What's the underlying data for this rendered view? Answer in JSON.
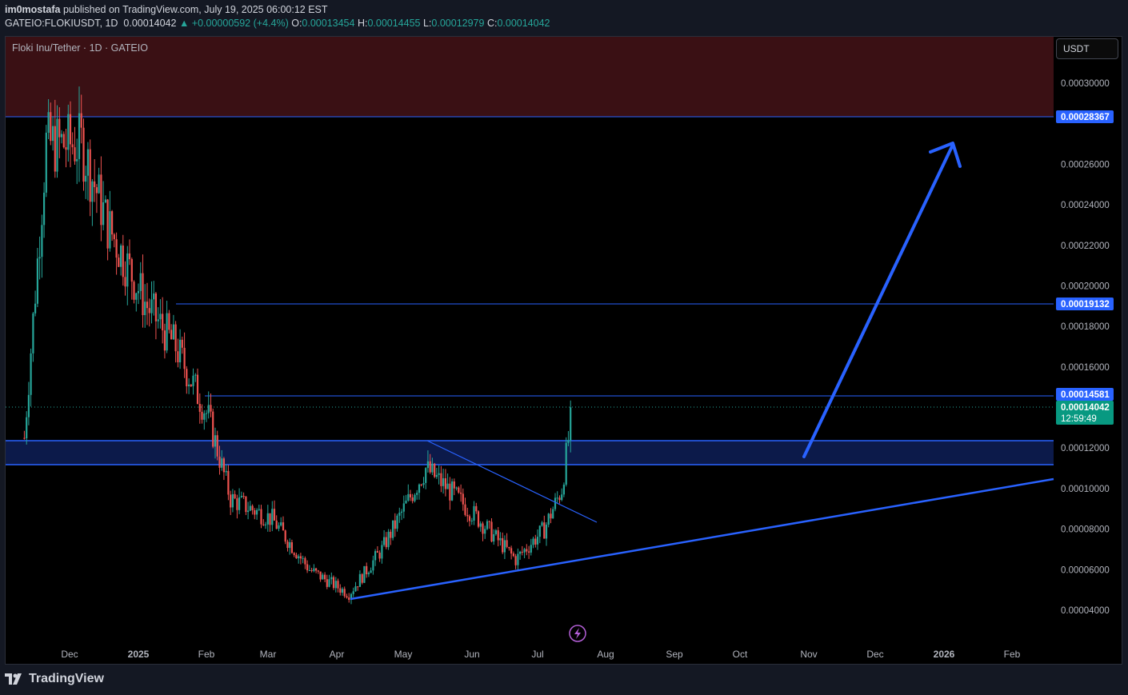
{
  "header": {
    "author": "im0mostafa",
    "published": "published on TradingView.com, July 19, 2025 06:00:12 EST",
    "symbol": "GATEIO:FLOKIUSDT, 1D",
    "last": "0.00014042",
    "change": "▲ +0.00000592 (+4.4%)",
    "o_label": "O:",
    "o": "0.00013454",
    "h_label": "H:",
    "h": "0.00014455",
    "l_label": "L:",
    "l": "0.00012979",
    "c_label": "C:",
    "c": "0.00014042"
  },
  "legend": "Floki Inu/Tether · 1D · GATEIO",
  "currency_button": "USDT",
  "footer": {
    "brand": "TradingView"
  },
  "colors": {
    "up": "#26a69a",
    "down": "#ef5350",
    "drawing": "#2962ff",
    "resistance_zone": "#3a1014",
    "support_zone": "#0c1a4a",
    "price_tag": "#089981"
  },
  "icons": {
    "lightning": "lightning-icon",
    "logo": "tradingview-logo-icon"
  },
  "chart_data": {
    "type": "candlestick",
    "title": "Floki Inu/Tether · 1D · GATEIO",
    "ylim": [
      3e-05,
      0.00032
    ],
    "grid": false,
    "x_ticks": [
      "Dec",
      "2025",
      "Feb",
      "Mar",
      "Apr",
      "May",
      "Jun",
      "Jul",
      "Aug",
      "Sep",
      "Oct",
      "Nov",
      "Dec",
      "2026",
      "Feb"
    ],
    "y_ticks": [
      "0.00004000",
      "0.00006000",
      "0.00008000",
      "0.00010000",
      "0.00012000",
      "0.00016000",
      "0.00018000",
      "0.00020000",
      "0.00022000",
      "0.00024000",
      "0.00026000",
      "0.00030000"
    ],
    "series": [
      {
        "dates": [
          "2024-11-10",
          "2024-11-20",
          "2024-12-06",
          "2024-12-18",
          "2025-01-05",
          "2025-01-18",
          "2025-02-02",
          "2025-02-12",
          "2025-03-03",
          "2025-03-20",
          "2025-04-07",
          "2025-04-22",
          "2025-05-12",
          "2025-05-22",
          "2025-06-05",
          "2025-06-22",
          "2025-07-05",
          "2025-07-13",
          "2025-07-18"
        ],
        "close": [
          0.000125,
          0.00027,
          0.00027,
          0.00023,
          0.00019,
          0.00017,
          0.000135,
          9.5e-05,
          8.5e-05,
          6e-05,
          4.8e-05,
          7e-05,
          0.00011,
          0.0001,
          8.5e-05,
          6.5e-05,
          8e-05,
          0.0001,
          0.00014042
        ]
      }
    ],
    "horizontal_levels": [
      {
        "value": 0.00028367,
        "label": "0.00028367"
      },
      {
        "value": 0.00019132,
        "label": "0.00019132"
      },
      {
        "value": 0.00014581,
        "label": "0.00014581"
      }
    ],
    "zones": [
      {
        "name": "resistance",
        "from": 0.00028367,
        "to": 0.00032
      },
      {
        "name": "support",
        "from": 0.000112,
        "to": 0.000124
      }
    ],
    "last_price": {
      "value": "0.00014042",
      "countdown": "12:59:49"
    },
    "annotations": [
      "ascending trendline from Apr 2025 low",
      "descending trendline from May 2025 high",
      "projection arrow toward 0.00027"
    ]
  }
}
